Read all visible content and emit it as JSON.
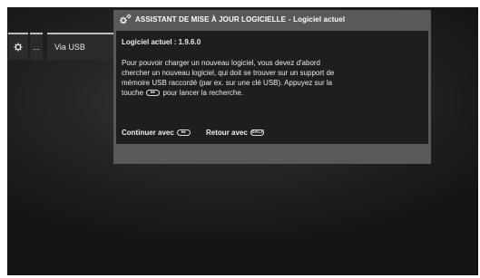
{
  "menu": {
    "settings_icon": "gear-icon",
    "more_label": "...",
    "usb_label": "Via USB"
  },
  "dialog": {
    "title_icon": "gears-icon",
    "title": "ASSISTANT DE MISE À JOUR LOGICIELLE",
    "title_suffix": "- Logiciel actuel",
    "current_version": "Logiciel actuel : 1.9.6.0",
    "text_before_key": "Pour pouvoir charger un nouveau logiciel, vous devez d'abord chercher un nouveau logiciel, qui doit se trouver sur un support de mémoire USB raccordé (par ex. sur une clé USB). Appuyez sur la touche",
    "text_after_key": "pour lancer la recherche.",
    "continue_label": "Continuer avec",
    "back_label": "Retour avec",
    "ok_key_glyph": "▸▸",
    "back_key_glyph": "BACK"
  },
  "colors": {
    "dialog_frame": "#595959",
    "dialog_body": "#1e1e1e",
    "screen_bg": "#262626",
    "tile_bg": "#2b2b2b"
  }
}
